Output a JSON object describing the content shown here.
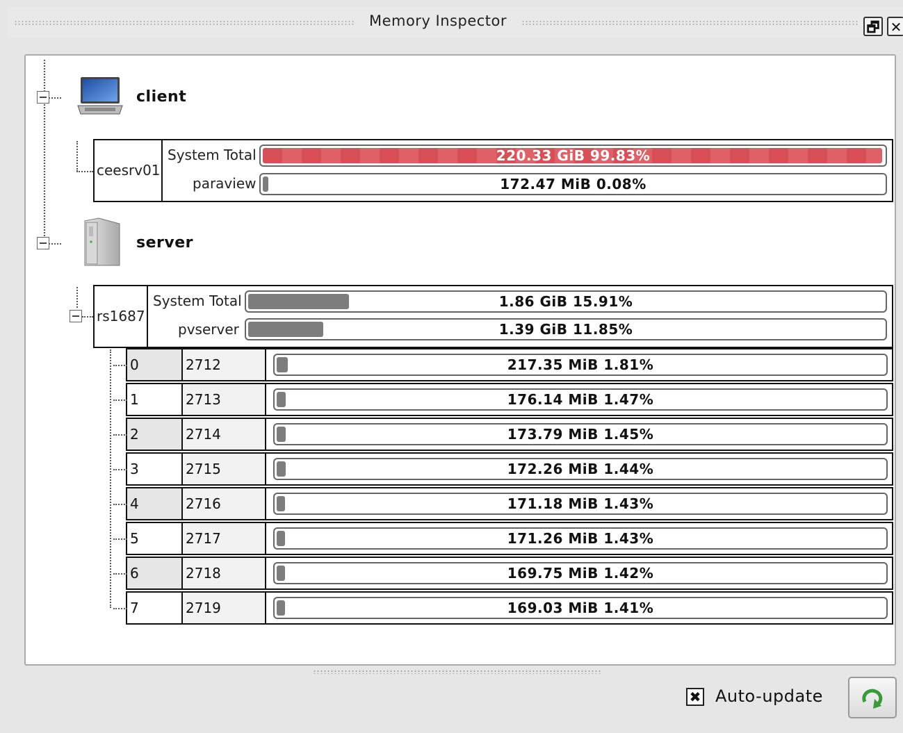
{
  "window": {
    "title": "Memory Inspector",
    "restore_glyph": "🗗",
    "close_glyph": "✕"
  },
  "hosts": [
    {
      "label": "client",
      "icon": "laptop-icon",
      "machine": "ceesrv01",
      "system_total_label": "System Total",
      "system_total_text": "220.33 GiB 99.83%",
      "system_total_fraction": 0.9983,
      "process_label": "paraview",
      "process_text": "172.47 MiB 0.08%",
      "process_fraction": 0.0008
    },
    {
      "label": "server",
      "icon": "server-tower-icon",
      "machine": "rs1687",
      "system_total_label": "System Total",
      "system_total_text": "1.86 GiB 15.91%",
      "system_total_fraction": 0.1591,
      "process_label": "pvserver",
      "process_text": "1.39 GiB 11.85%",
      "process_fraction": 0.1185
    }
  ],
  "ranks": [
    {
      "rank": "0",
      "pid": "2712",
      "text": "217.35 MiB 1.81%",
      "fraction": 0.0181
    },
    {
      "rank": "1",
      "pid": "2713",
      "text": "176.14 MiB 1.47%",
      "fraction": 0.0147
    },
    {
      "rank": "2",
      "pid": "2714",
      "text": "173.79 MiB 1.45%",
      "fraction": 0.0145
    },
    {
      "rank": "3",
      "pid": "2715",
      "text": "172.26 MiB 1.44%",
      "fraction": 0.0144
    },
    {
      "rank": "4",
      "pid": "2716",
      "text": "171.18 MiB 1.43%",
      "fraction": 0.0143
    },
    {
      "rank": "5",
      "pid": "2717",
      "text": "171.26 MiB 1.43%",
      "fraction": 0.0143
    },
    {
      "rank": "6",
      "pid": "2718",
      "text": "169.75 MiB 1.42%",
      "fraction": 0.0142
    },
    {
      "rank": "7",
      "pid": "2719",
      "text": "169.03 MiB 1.41%",
      "fraction": 0.0141
    }
  ],
  "colors": {
    "critical_fill": "#d94f58",
    "normal_fill": "#7d7d7d"
  },
  "footer": {
    "auto_update_label": "Auto-update",
    "auto_update_checked": true,
    "refresh_icon": "refresh-icon"
  }
}
